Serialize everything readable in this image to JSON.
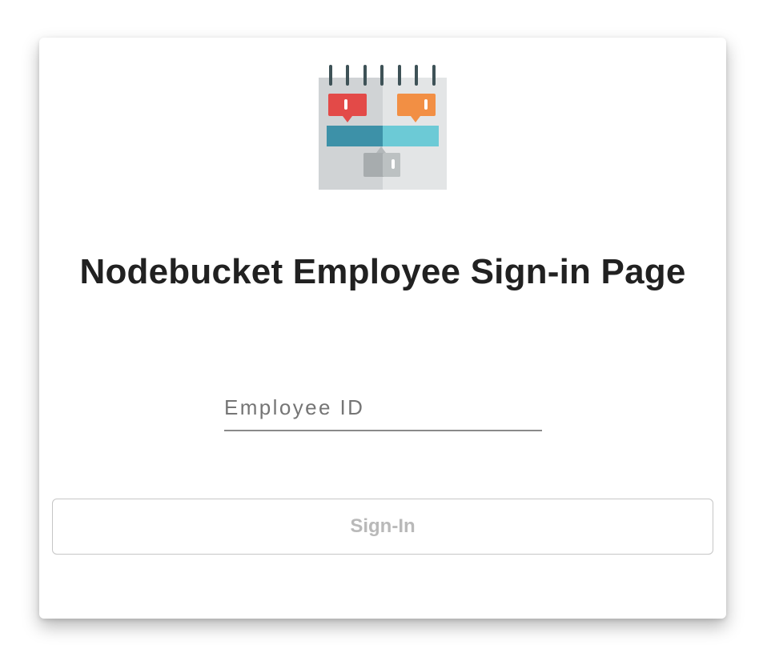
{
  "logo": {
    "icon": "calendar-icon"
  },
  "page_title": "Nodebucket Employee Sign-in Page",
  "employee_id_field": {
    "placeholder": "Employee ID",
    "value": ""
  },
  "signin_button": {
    "label": "Sign-In",
    "disabled": true
  },
  "colors": {
    "calendar_red": "#e34a48",
    "calendar_orange": "#f28f44",
    "calendar_teal_dark": "#3d91a8",
    "calendar_teal_light": "#6ccad6",
    "calendar_body": "#d9dbdc",
    "button_text_disabled": "#b9b9b9"
  }
}
